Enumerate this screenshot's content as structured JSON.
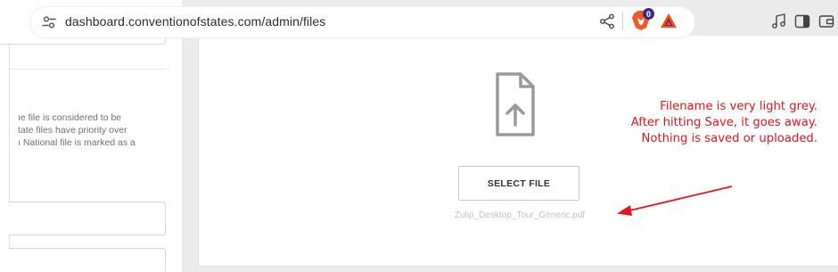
{
  "browser": {
    "url": "dashboard.conventionofstates.com/admin/files",
    "shields_badge": "0",
    "icons": [
      "site-settings-icon",
      "share-icon",
      "brave-shields-icon",
      "bat-rewards-icon",
      "media-icon",
      "sidebar-toggle-icon",
      "wallet-icon"
    ]
  },
  "left_panel": {
    "help_text": "ıe file is considered to be\ntate files have priority over\nı National file is marked as a"
  },
  "upload": {
    "select_label": "SELECT FILE",
    "filename": "Zulip_Desktop_Tour_Generic.pdf"
  },
  "annotation": {
    "text": "Filename is very light grey.\nAfter hitting Save, it goes away.\nNothing is saved or uploaded.",
    "color": "#e8141b"
  },
  "colors": {
    "annotation_red": "#e8141b",
    "filename_grey": "#c2c2c2",
    "icon_grey": "#9a9a9a"
  }
}
